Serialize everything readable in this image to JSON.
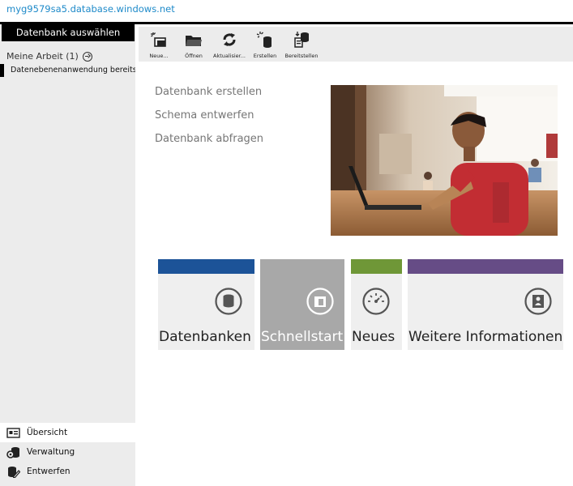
{
  "server": {
    "name": "myg9579sa5.database.windows.net"
  },
  "sidebar": {
    "select_db_label": "Datenbank auswählen",
    "my_work_label": "Meine Arbeit (1)",
    "work_item": "Datenebenenanwendung bereitstellen",
    "nav": [
      {
        "label": "Übersicht",
        "icon": "overview-icon"
      },
      {
        "label": "Verwaltung",
        "icon": "administration-icon"
      },
      {
        "label": "Entwerfen",
        "icon": "design-icon"
      }
    ]
  },
  "toolbar": {
    "buttons": [
      {
        "label": "Neue...",
        "icon": "new-query-icon"
      },
      {
        "label": "Öffnen",
        "icon": "open-folder-icon"
      },
      {
        "label": "Aktualisier...",
        "icon": "refresh-icon"
      },
      {
        "label": "Erstellen",
        "icon": "create-database-icon"
      },
      {
        "label": "Bereitstellen",
        "icon": "deploy-icon"
      }
    ]
  },
  "main": {
    "links": [
      "Datenbank erstellen",
      "Schema entwerfen",
      "Datenbank abfragen"
    ],
    "tiles": [
      {
        "label": "Datenbanken",
        "color": "#1c5398",
        "icon": "database-icon"
      },
      {
        "label": "Schnellstart",
        "color": "#a8a8a8",
        "icon": "quickstart-icon"
      },
      {
        "label": "Neues",
        "color": "#6f9737",
        "icon": "whats-new-icon"
      },
      {
        "label": "Weitere Informationen",
        "color": "#664c86",
        "icon": "more-info-icon"
      }
    ]
  }
}
